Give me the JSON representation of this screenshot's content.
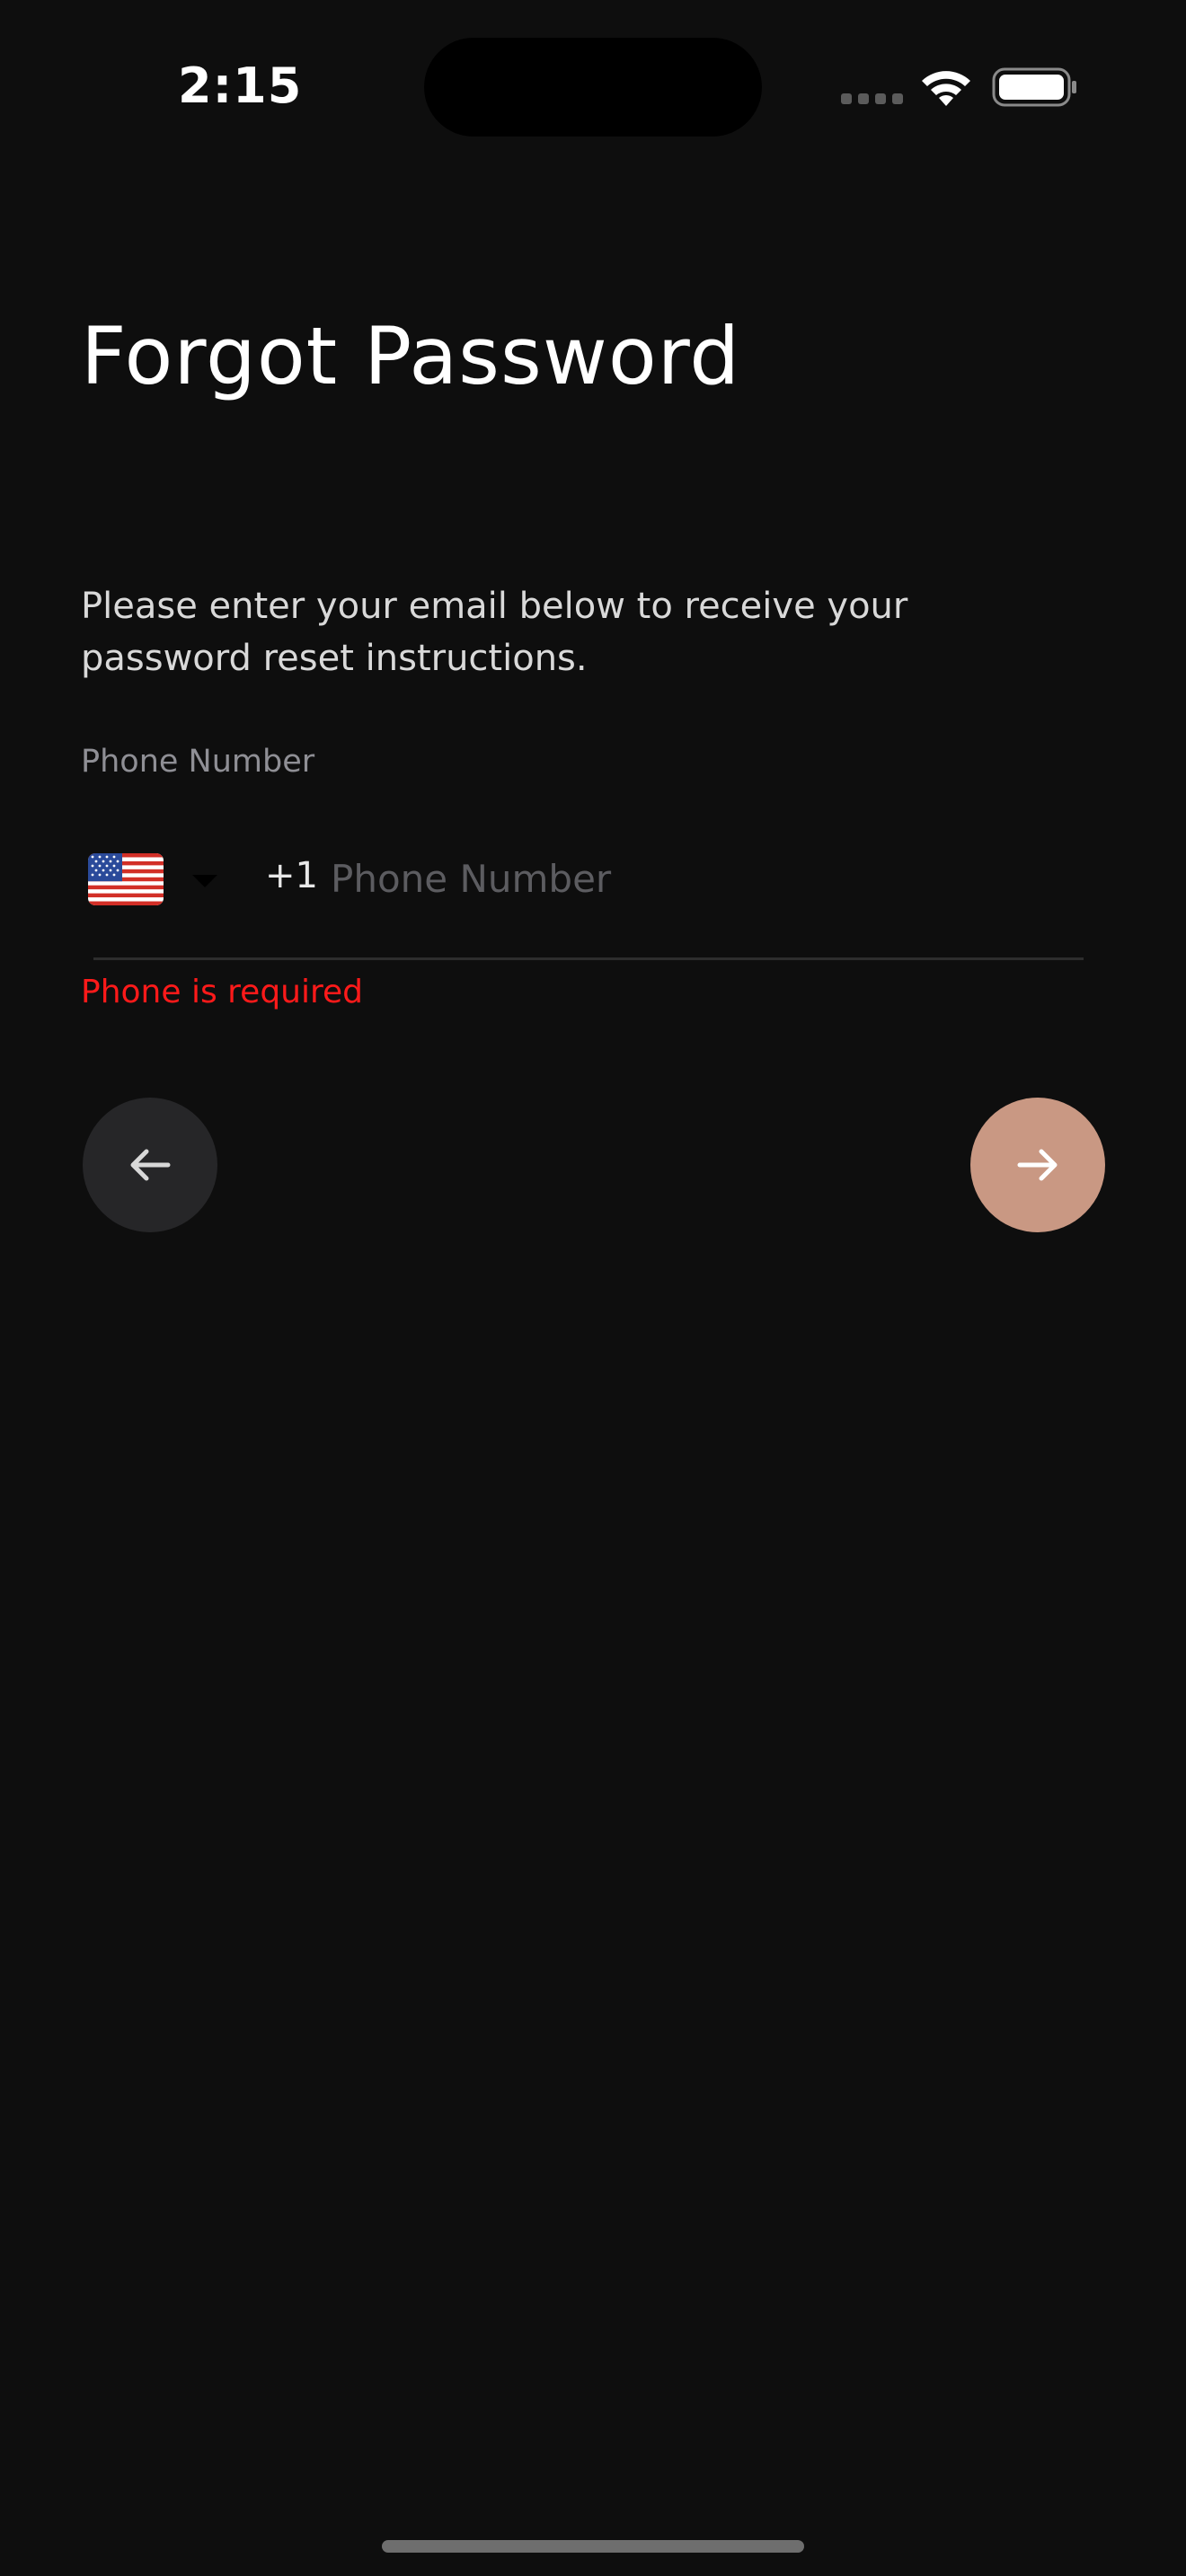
{
  "status_bar": {
    "time": "2:15"
  },
  "screen": {
    "title": "Forgot Password",
    "instructions": "Please enter your email below to receive your password reset instructions."
  },
  "phone_field": {
    "label": "Phone Number",
    "country_flag": "us-flag",
    "dial_code": "+1",
    "value": "",
    "placeholder": "Phone Number",
    "error": "Phone is required"
  },
  "icons": {
    "back": "arrow-left-icon",
    "next": "arrow-right-icon"
  },
  "colors": {
    "background": "#0e0e0e",
    "accent": "#c99883",
    "error": "#ff1a1a",
    "secondary_button": "#262628"
  }
}
